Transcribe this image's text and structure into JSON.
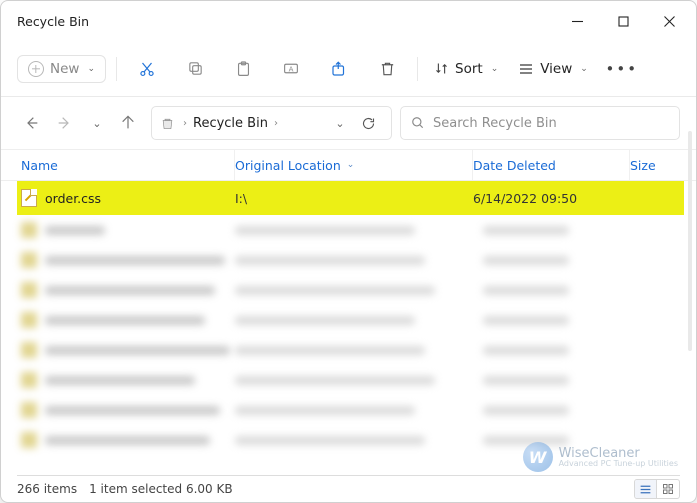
{
  "titlebar": {
    "title": "Recycle Bin"
  },
  "toolbar": {
    "new_label": "New",
    "sort_label": "Sort",
    "view_label": "View"
  },
  "address": {
    "location_label": "Recycle Bin"
  },
  "search": {
    "placeholder": "Search Recycle Bin"
  },
  "columns": {
    "name": "Name",
    "original": "Original Location",
    "date_deleted": "Date Deleted",
    "size": "Size"
  },
  "rows": [
    {
      "name": "order.css",
      "original_location": "I:\\",
      "date_deleted": "6/14/2022 09:50",
      "selected": true
    }
  ],
  "blurred_row_count": 8,
  "status": {
    "count_text": "266 items",
    "selection_text": "1 item selected  6.00 KB"
  },
  "watermark": {
    "brand": "WiseCleaner",
    "tagline": "Advanced PC Tune-up Utilities",
    "badge_letter": "W"
  }
}
